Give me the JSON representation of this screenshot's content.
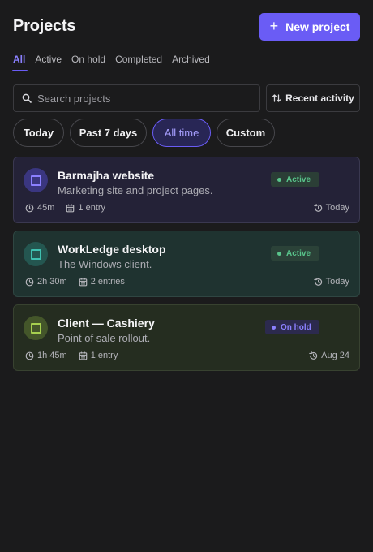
{
  "header": {
    "title": "Projects",
    "new_button_label": "New project"
  },
  "tabs": [
    {
      "label": "All",
      "active": true
    },
    {
      "label": "Active",
      "active": false
    },
    {
      "label": "On hold",
      "active": false
    },
    {
      "label": "Completed",
      "active": false
    },
    {
      "label": "Archived",
      "active": false
    }
  ],
  "search": {
    "placeholder": "Search projects",
    "value": ""
  },
  "sort": {
    "label": "Recent activity"
  },
  "date_filters": [
    {
      "label": "Today",
      "active": false
    },
    {
      "label": "Past 7 days",
      "active": false
    },
    {
      "label": "All time",
      "active": true
    },
    {
      "label": "Custom",
      "active": false
    }
  ],
  "projects": [
    {
      "name": "Barmajha website",
      "description": "Marketing site and project pages.",
      "status": "Active",
      "duration": "45m",
      "entries": "1 entry",
      "updated": "Today",
      "colors": {
        "bg": "#242237",
        "border": "#3a3850",
        "icon_bg": "#3a3680",
        "icon": "#8b80ff",
        "badge_bg": "#2b3e36",
        "badge_text": "#59c48b"
      }
    },
    {
      "name": "WorkLedge desktop",
      "description": "The Windows client.",
      "status": "Active",
      "duration": "2h 30m",
      "entries": "2 entries",
      "updated": "Today",
      "colors": {
        "bg": "#1f3330",
        "border": "#2f4642",
        "icon_bg": "#245650",
        "icon": "#3fc0b0",
        "badge_bg": "#2b4238",
        "badge_text": "#59c48b"
      }
    },
    {
      "name": "Client — Cashiery",
      "description": "Point of sale rollout.",
      "status": "On hold",
      "duration": "1h 45m",
      "entries": "1 entry",
      "updated": "Aug 24",
      "colors": {
        "bg": "#252d20",
        "border": "#384230",
        "icon_bg": "#44562a",
        "icon": "#a6d04f",
        "badge_bg": "#2c2a4e",
        "badge_text": "#8b80ff"
      }
    }
  ],
  "accent": "#6a5cf5"
}
